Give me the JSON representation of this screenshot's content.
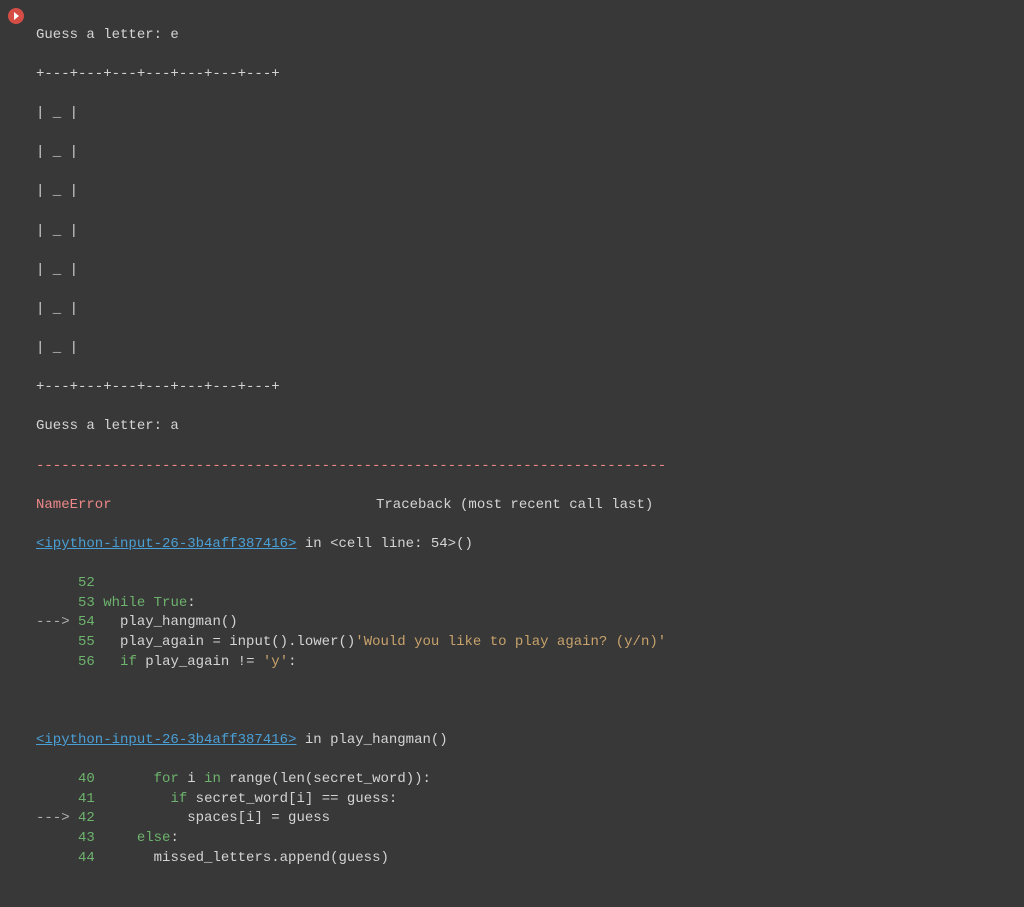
{
  "output": {
    "prompt1": "Guess a letter: e",
    "sepRow": "+---+---+---+---+---+---+---+",
    "boardRow": "| _ |",
    "prompt2": "Guess a letter: a",
    "dashLine": "---------------------------------------------------------------------------"
  },
  "traceback": {
    "errorName": "NameError",
    "tbLabel": "Traceback (most recent call last)",
    "frame1": {
      "link": "<ipython-input-26-3b4aff387416>",
      "in": " in ",
      "loc": "<cell line: 54>()",
      "lines": [
        {
          "arrow": "     ",
          "num": "52",
          "pre": "",
          "kw": "",
          "post": ""
        },
        {
          "arrow": "     ",
          "num": "53",
          "pre": " ",
          "kw": "while",
          "post": " ",
          "kw2": "True",
          "post2": ":"
        },
        {
          "arrow": "---> ",
          "num": "54",
          "pre": "   play_hangman()",
          "kw": "",
          "post": ""
        },
        {
          "arrow": "     ",
          "num": "55",
          "pre": "   play_again = input(",
          "str": "'Would you like to play again? (y/n)'",
          "post": ").lower()"
        },
        {
          "arrow": "     ",
          "num": "56",
          "pre": "   ",
          "kw": "if",
          "post": " play_again != ",
          "str": "'y'",
          "post2": ":"
        }
      ]
    },
    "frame2": {
      "link": "<ipython-input-26-3b4aff387416>",
      "in": " in ",
      "loc": "play_hangman()",
      "lines": [
        {
          "arrow": "     ",
          "num": "40",
          "pre": "       ",
          "kw": "for",
          "post": " i ",
          "kw2": "in",
          "post2": " range(len(secret_word)):"
        },
        {
          "arrow": "     ",
          "num": "41",
          "pre": "         ",
          "kw": "if",
          "post": " secret_word[i] == guess:"
        },
        {
          "arrow": "---> ",
          "num": "42",
          "pre": "           spaces[i] = guess",
          "kw": "",
          "post": ""
        },
        {
          "arrow": "     ",
          "num": "43",
          "pre": "     ",
          "kw": "else",
          "post": ":"
        },
        {
          "arrow": "     ",
          "num": "44",
          "pre": "       missed_letters.append(guess)",
          "kw": "",
          "post": ""
        }
      ]
    }
  }
}
